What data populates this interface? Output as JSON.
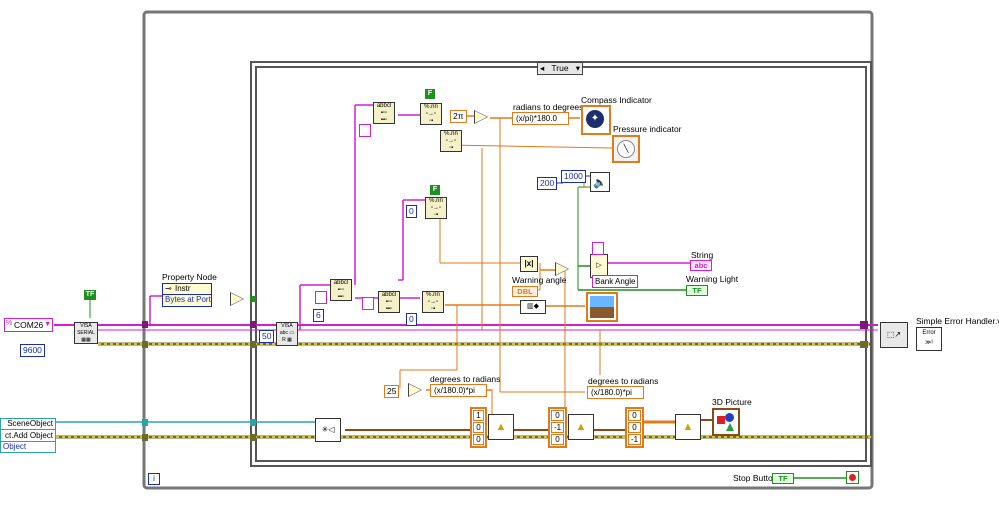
{
  "case_selector": {
    "value": "True"
  },
  "property_node": {
    "title": "Property Node",
    "class_label": "Instr",
    "property": "Bytes at Port"
  },
  "controls": {
    "com_port": "COM26",
    "baud": "9600",
    "const_50": "50",
    "const_6": "6",
    "const_0a": "0",
    "const_0b": "0",
    "const_25": "25",
    "const_200": "200",
    "const_1000": "1000",
    "const_2pi": "2π",
    "const_warning_angle": "DBL",
    "f1": "F",
    "f2": "F",
    "tf_loop": "TF",
    "iteration": "i"
  },
  "labels": {
    "radians_to_degrees": "radians to degrees",
    "formula_r2d": "(x/pi)*180.0",
    "compass": "Compass Indicator",
    "pressure": "Pressure indicator",
    "warning_angle": "Warning angle",
    "bank_angle": "Bank Angle",
    "string": "String",
    "string_ind": "abc",
    "warning_light": "Warning Light",
    "warning_light_ind": "TF",
    "degrees_to_radians_1": "degrees to radians",
    "formula_d2r_1": "(x/180.0)*pi",
    "degrees_to_radians_2": "degrees to radians",
    "formula_d2r_2": "(x/180.0)*pi",
    "picture_3d": "3D Picture",
    "error_handler": "Simple Error Handler.vi",
    "stop_button": "Stop Button",
    "stop_ind": "TF"
  },
  "scene": {
    "row1": "SceneObject",
    "row2": "ct.Add Object",
    "row3": "Object"
  },
  "arrays": {
    "arr1": [
      "1",
      "0",
      "0"
    ],
    "arr2": [
      "0",
      "-1",
      "0"
    ],
    "arr3": [
      "0",
      "0",
      "-1"
    ]
  },
  "colors": {
    "wire_pink": "#d020d0",
    "wire_orange": "#e07a1a",
    "wire_green": "#1f8f1f",
    "wire_teal": "#2aa5a5",
    "wire_blue": "#1a2fb0",
    "error_cluster": "#6b6b2a"
  }
}
